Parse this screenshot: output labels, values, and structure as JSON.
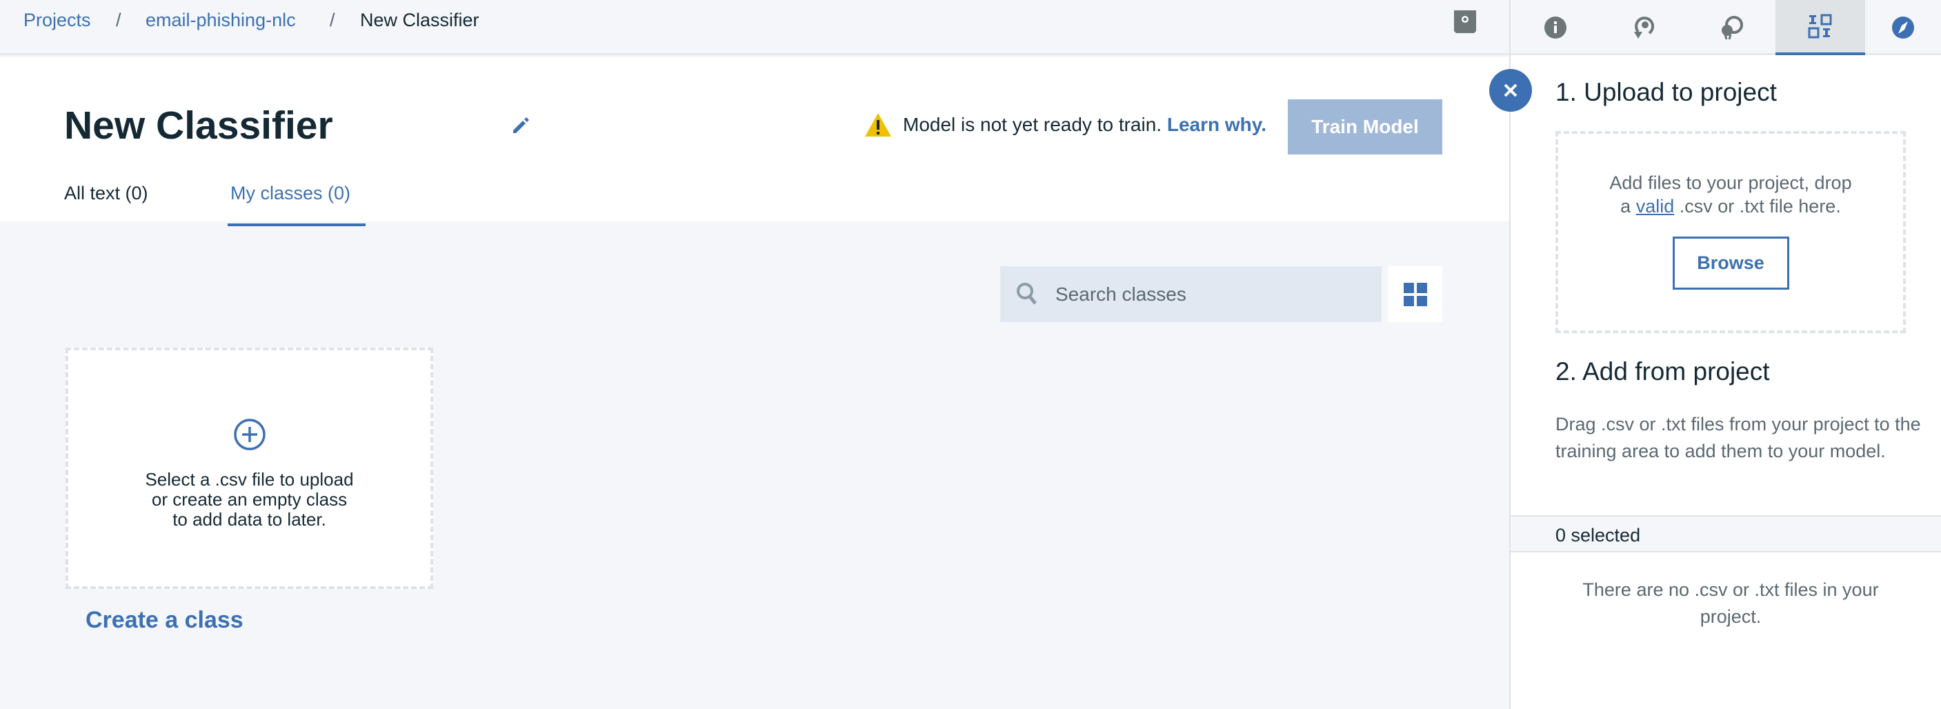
{
  "breadcrumb": {
    "items": [
      "Projects",
      "email-phishing-nlc",
      "New Classifier"
    ],
    "separator": "/"
  },
  "header": {
    "title": "New Classifier",
    "warning": "Model is not yet ready to train.",
    "learn_why": "Learn why.",
    "train_button": "Train Model"
  },
  "tabs": [
    {
      "label": "All text (0)",
      "active": false
    },
    {
      "label": "My classes (0)",
      "active": true
    }
  ],
  "search": {
    "placeholder": "Search classes"
  },
  "card": {
    "lines": [
      "Select a .csv file to upload",
      "or create an empty class",
      "to add data to later."
    ],
    "link": "Create a class"
  },
  "toolbar_icons": [
    "project-icon",
    "info-icon",
    "history-icon",
    "connection-icon",
    "data-icon",
    "compass-icon"
  ],
  "panel": {
    "upload_title": "1. Upload to project",
    "drop_text_1": "Add files to your project, drop",
    "drop_text_a": "a",
    "drop_link": "valid",
    "drop_text_2": ".csv or .txt file here.",
    "browse": "Browse",
    "add_title": "2. Add from project",
    "add_text": "Drag .csv or .txt files from your project to the training area to add them to your model.",
    "selected": "0 selected",
    "empty": "There are no .csv or .txt files in your project."
  },
  "colors": {
    "accent": "#3d70b2",
    "warning": "#efc100",
    "disabled": "#a0b8d8"
  }
}
